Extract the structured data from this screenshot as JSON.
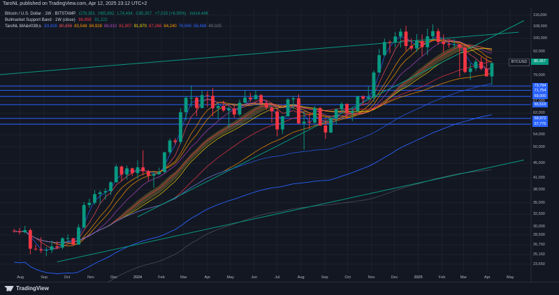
{
  "header": {
    "published": "TaroNL published on TradingView.com, Apr 12, 2025 23:12 UTC+2",
    "symbol_line": {
      "name": "Bitcoin / U.S. Dollar · 1W · BITSTAMP",
      "o": "O78,381",
      "h": "H85,892",
      "l": "L74,434",
      "c": "C85,357",
      "chg": "+7,015 (+8.95%)",
      "vol": "Vol14.44K"
    },
    "indicator1": {
      "name": "Bullmarket Support Band · 1W (close)",
      "v1": "86,858",
      "v2": "91,222"
    },
    "indicator2": {
      "name": "TaroNL MA&#039;s",
      "values": [
        "83,926",
        "80,656",
        "83,548",
        "84,928",
        "86,910",
        "91,907",
        "91,970",
        "87,266",
        "84,240",
        "76,945",
        "58,488",
        "40,025"
      ],
      "colors": [
        "#2962ff",
        "#f7525f",
        "#ff9800",
        "#ff9800",
        "#ab47bc",
        "#f23645",
        "#f5d90a",
        "#f23645",
        "#ff9800",
        "#2962ff",
        "#2962ff",
        "#787b86"
      ]
    }
  },
  "price_axis": [
    "116,000",
    "108,000",
    "100,000",
    "92,000",
    "85,000",
    "79,000",
    "73,000",
    "67,000",
    "62,000",
    "58,000",
    "54,000",
    "50,000",
    "45,000",
    "41,000",
    "38,000",
    "35,000",
    "32,500",
    "30,000",
    "28,500",
    "26,750",
    "25,150",
    "23,650"
  ],
  "horizontal_levels": [
    "73,794",
    "71,754",
    "69,000",
    "65,510",
    "59,972",
    "57,775"
  ],
  "current": {
    "tag": "BTCUSD",
    "price": "85,357"
  },
  "time_axis": [
    "Aug",
    "Sep",
    "Oct",
    "Nov",
    "Dec",
    "2024",
    "Feb",
    "Mar",
    "Apr",
    "May",
    "Jun",
    "Jul",
    "Aug",
    "Sep",
    "Oct",
    "Nov",
    "Dec",
    "2025",
    "Feb",
    "Mar",
    "Apr",
    "May"
  ],
  "footer": {
    "brand": "TradingView"
  },
  "colors": {
    "up": "#089981",
    "down": "#f23645",
    "level": "#2962ff",
    "channel": "#089981"
  },
  "chart_data": {
    "type": "candlestick",
    "title": "Bitcoin / U.S. Dollar · 1W · BITSTAMP",
    "y_scale": "log",
    "ylim": [
      22500,
      120000
    ],
    "xlim": [
      "2023-07-31",
      "2025-05-19"
    ],
    "candles": [
      {
        "t": "2023-07-24",
        "o": 29300,
        "h": 29600,
        "l": 28900,
        "c": 29200
      },
      {
        "t": "2023-07-31",
        "o": 29200,
        "h": 29800,
        "l": 28600,
        "c": 29000
      },
      {
        "t": "2023-08-07",
        "o": 29000,
        "h": 30200,
        "l": 28800,
        "c": 29400
      },
      {
        "t": "2023-08-14",
        "o": 29400,
        "h": 29700,
        "l": 25200,
        "c": 26100
      },
      {
        "t": "2023-08-21",
        "o": 26100,
        "h": 26800,
        "l": 25800,
        "c": 26000
      },
      {
        "t": "2023-08-28",
        "o": 26000,
        "h": 28100,
        "l": 25400,
        "c": 25800
      },
      {
        "t": "2023-09-04",
        "o": 25800,
        "h": 26400,
        "l": 24900,
        "c": 25900
      },
      {
        "t": "2023-09-11",
        "o": 25900,
        "h": 27500,
        "l": 25400,
        "c": 26500
      },
      {
        "t": "2023-09-18",
        "o": 26500,
        "h": 27400,
        "l": 26100,
        "c": 26300
      },
      {
        "t": "2023-09-25",
        "o": 26300,
        "h": 28100,
        "l": 26000,
        "c": 27900
      },
      {
        "t": "2023-10-02",
        "o": 27900,
        "h": 28600,
        "l": 27200,
        "c": 27900
      },
      {
        "t": "2023-10-09",
        "o": 27900,
        "h": 28000,
        "l": 26600,
        "c": 26800
      },
      {
        "t": "2023-10-16",
        "o": 26800,
        "h": 30500,
        "l": 26800,
        "c": 29900
      },
      {
        "t": "2023-10-23",
        "o": 29900,
        "h": 35200,
        "l": 29700,
        "c": 34500
      },
      {
        "t": "2023-10-30",
        "o": 34500,
        "h": 35900,
        "l": 33900,
        "c": 35000
      },
      {
        "t": "2023-11-06",
        "o": 35000,
        "h": 37900,
        "l": 34600,
        "c": 37000
      },
      {
        "t": "2023-11-13",
        "o": 37000,
        "h": 37900,
        "l": 34800,
        "c": 37400
      },
      {
        "t": "2023-11-20",
        "o": 37400,
        "h": 38400,
        "l": 35700,
        "c": 37700
      },
      {
        "t": "2023-11-27",
        "o": 37700,
        "h": 40200,
        "l": 36800,
        "c": 39900
      },
      {
        "t": "2023-12-04",
        "o": 39900,
        "h": 44700,
        "l": 39800,
        "c": 44100
      },
      {
        "t": "2023-12-11",
        "o": 44100,
        "h": 44400,
        "l": 40200,
        "c": 41900
      },
      {
        "t": "2023-12-18",
        "o": 41900,
        "h": 44400,
        "l": 40600,
        "c": 43600
      },
      {
        "t": "2023-12-25",
        "o": 43600,
        "h": 43800,
        "l": 41500,
        "c": 42300
      },
      {
        "t": "2024-01-01",
        "o": 42300,
        "h": 45900,
        "l": 40800,
        "c": 43900
      },
      {
        "t": "2024-01-08",
        "o": 43900,
        "h": 48900,
        "l": 41700,
        "c": 42800
      },
      {
        "t": "2024-01-15",
        "o": 42800,
        "h": 43200,
        "l": 40300,
        "c": 41600
      },
      {
        "t": "2024-01-22",
        "o": 41600,
        "h": 42900,
        "l": 38500,
        "c": 42000
      },
      {
        "t": "2024-01-29",
        "o": 42000,
        "h": 43800,
        "l": 41900,
        "c": 42600
      },
      {
        "t": "2024-02-05",
        "o": 42600,
        "h": 48500,
        "l": 42300,
        "c": 48300
      },
      {
        "t": "2024-02-12",
        "o": 48300,
        "h": 52800,
        "l": 47700,
        "c": 52100
      },
      {
        "t": "2024-02-19",
        "o": 52100,
        "h": 52900,
        "l": 50700,
        "c": 51600
      },
      {
        "t": "2024-02-26",
        "o": 51600,
        "h": 64000,
        "l": 50900,
        "c": 62400
      },
      {
        "t": "2024-03-04",
        "o": 62400,
        "h": 69200,
        "l": 59200,
        "c": 68400
      },
      {
        "t": "2024-03-11",
        "o": 68400,
        "h": 73800,
        "l": 64500,
        "c": 68400
      },
      {
        "t": "2024-03-18",
        "o": 68400,
        "h": 68900,
        "l": 60800,
        "c": 64100
      },
      {
        "t": "2024-03-25",
        "o": 64100,
        "h": 71700,
        "l": 64000,
        "c": 69600
      },
      {
        "t": "2024-04-01",
        "o": 69600,
        "h": 71300,
        "l": 64500,
        "c": 69300
      },
      {
        "t": "2024-04-08",
        "o": 69300,
        "h": 72800,
        "l": 60800,
        "c": 64000
      },
      {
        "t": "2024-04-15",
        "o": 64000,
        "h": 66200,
        "l": 59600,
        "c": 64900
      },
      {
        "t": "2024-04-22",
        "o": 64900,
        "h": 67200,
        "l": 62500,
        "c": 63100
      },
      {
        "t": "2024-04-29",
        "o": 63100,
        "h": 64700,
        "l": 56500,
        "c": 63900
      },
      {
        "t": "2024-05-06",
        "o": 63900,
        "h": 65500,
        "l": 60200,
        "c": 61500
      },
      {
        "t": "2024-05-13",
        "o": 61500,
        "h": 67700,
        "l": 60800,
        "c": 66300
      },
      {
        "t": "2024-05-20",
        "o": 66300,
        "h": 71900,
        "l": 66100,
        "c": 68500
      },
      {
        "t": "2024-05-27",
        "o": 68500,
        "h": 70600,
        "l": 66700,
        "c": 67800
      },
      {
        "t": "2024-06-03",
        "o": 67800,
        "h": 71900,
        "l": 67600,
        "c": 69600
      },
      {
        "t": "2024-06-10",
        "o": 69600,
        "h": 70100,
        "l": 64800,
        "c": 66200
      },
      {
        "t": "2024-06-17",
        "o": 66200,
        "h": 67200,
        "l": 63400,
        "c": 64300
      },
      {
        "t": "2024-06-24",
        "o": 64300,
        "h": 64600,
        "l": 58400,
        "c": 62700
      },
      {
        "t": "2024-07-01",
        "o": 62700,
        "h": 63800,
        "l": 53500,
        "c": 55900
      },
      {
        "t": "2024-07-08",
        "o": 55900,
        "h": 61000,
        "l": 54300,
        "c": 60800
      },
      {
        "t": "2024-07-15",
        "o": 60800,
        "h": 68300,
        "l": 60700,
        "c": 67700
      },
      {
        "t": "2024-07-22",
        "o": 67700,
        "h": 69300,
        "l": 63500,
        "c": 68200
      },
      {
        "t": "2024-07-29",
        "o": 68200,
        "h": 70000,
        "l": 57800,
        "c": 58100
      },
      {
        "t": "2024-08-05",
        "o": 58100,
        "h": 62700,
        "l": 49100,
        "c": 58700
      },
      {
        "t": "2024-08-12",
        "o": 58700,
        "h": 61800,
        "l": 56100,
        "c": 58400
      },
      {
        "t": "2024-08-19",
        "o": 58400,
        "h": 65000,
        "l": 57800,
        "c": 64100
      },
      {
        "t": "2024-08-26",
        "o": 64100,
        "h": 64500,
        "l": 57200,
        "c": 57300
      },
      {
        "t": "2024-09-02",
        "o": 57300,
        "h": 59800,
        "l": 52600,
        "c": 54800
      },
      {
        "t": "2024-09-09",
        "o": 54800,
        "h": 60600,
        "l": 54600,
        "c": 59900
      },
      {
        "t": "2024-09-16",
        "o": 59900,
        "h": 64000,
        "l": 57600,
        "c": 63600
      },
      {
        "t": "2024-09-23",
        "o": 63600,
        "h": 66500,
        "l": 62700,
        "c": 65800
      },
      {
        "t": "2024-09-30",
        "o": 65800,
        "h": 66000,
        "l": 59900,
        "c": 62100
      },
      {
        "t": "2024-10-07",
        "o": 62100,
        "h": 64400,
        "l": 58900,
        "c": 62900
      },
      {
        "t": "2024-10-14",
        "o": 62900,
        "h": 69400,
        "l": 62400,
        "c": 69000
      },
      {
        "t": "2024-10-21",
        "o": 69000,
        "h": 69500,
        "l": 65100,
        "c": 68000
      },
      {
        "t": "2024-10-28",
        "o": 68000,
        "h": 73600,
        "l": 67600,
        "c": 68700
      },
      {
        "t": "2024-11-04",
        "o": 68700,
        "h": 81500,
        "l": 66800,
        "c": 80400
      },
      {
        "t": "2024-11-11",
        "o": 80400,
        "h": 93400,
        "l": 80200,
        "c": 89800
      },
      {
        "t": "2024-11-18",
        "o": 89800,
        "h": 99800,
        "l": 89300,
        "c": 97700
      },
      {
        "t": "2024-11-25",
        "o": 97700,
        "h": 98700,
        "l": 90800,
        "c": 97300
      },
      {
        "t": "2024-12-02",
        "o": 97300,
        "h": 104000,
        "l": 94500,
        "c": 101200
      },
      {
        "t": "2024-12-09",
        "o": 101200,
        "h": 106500,
        "l": 94300,
        "c": 104400
      },
      {
        "t": "2024-12-16",
        "o": 104400,
        "h": 108300,
        "l": 92200,
        "c": 95200
      },
      {
        "t": "2024-12-23",
        "o": 95200,
        "h": 99900,
        "l": 92500,
        "c": 93700
      },
      {
        "t": "2024-12-30",
        "o": 93700,
        "h": 102700,
        "l": 91800,
        "c": 98300
      },
      {
        "t": "2025-01-06",
        "o": 98300,
        "h": 102500,
        "l": 89300,
        "c": 94500
      },
      {
        "t": "2025-01-13",
        "o": 94500,
        "h": 106400,
        "l": 89800,
        "c": 101300
      },
      {
        "t": "2025-01-20",
        "o": 101300,
        "h": 109300,
        "l": 99500,
        "c": 104700
      },
      {
        "t": "2025-01-27",
        "o": 104700,
        "h": 106500,
        "l": 96000,
        "c": 97700
      },
      {
        "t": "2025-02-03",
        "o": 97700,
        "h": 102500,
        "l": 91200,
        "c": 96400
      },
      {
        "t": "2025-02-10",
        "o": 96400,
        "h": 98900,
        "l": 94100,
        "c": 96100
      },
      {
        "t": "2025-02-17",
        "o": 96100,
        "h": 99500,
        "l": 93500,
        "c": 96300
      },
      {
        "t": "2025-02-24",
        "o": 96300,
        "h": 96500,
        "l": 78200,
        "c": 94200
      },
      {
        "t": "2025-03-03",
        "o": 94200,
        "h": 95000,
        "l": 80000,
        "c": 80700
      },
      {
        "t": "2025-03-10",
        "o": 80700,
        "h": 85300,
        "l": 76600,
        "c": 82600
      },
      {
        "t": "2025-03-17",
        "o": 82600,
        "h": 87400,
        "l": 81200,
        "c": 86100
      },
      {
        "t": "2025-03-24",
        "o": 86100,
        "h": 88800,
        "l": 81600,
        "c": 82400
      },
      {
        "t": "2025-03-31",
        "o": 82400,
        "h": 88500,
        "l": 81300,
        "c": 78400
      },
      {
        "t": "2025-04-07",
        "o": 78381,
        "h": 85892,
        "l": 74434,
        "c": 85357
      }
    ],
    "horizontal_levels": [
      73794,
      71754,
      69000,
      65510,
      59972,
      57775
    ],
    "trendlines": [
      {
        "name": "",
        "from": [
          "2023-06-26",
          79000
        ],
        "to": [
          "2025-05-12",
          104000
        ],
        "color": "#089981"
      },
      {
        "name": "",
        "from": [
          "2023-09-18",
          24000
        ],
        "to": [
          "2025-05-19",
          46000
        ],
        "color": "#089981"
      },
      {
        "name": "",
        "from": [
          "2024-01-01",
          32000
        ],
        "to": [
          "2025-05-19",
          112000
        ],
        "color": "#089981"
      }
    ]
  }
}
